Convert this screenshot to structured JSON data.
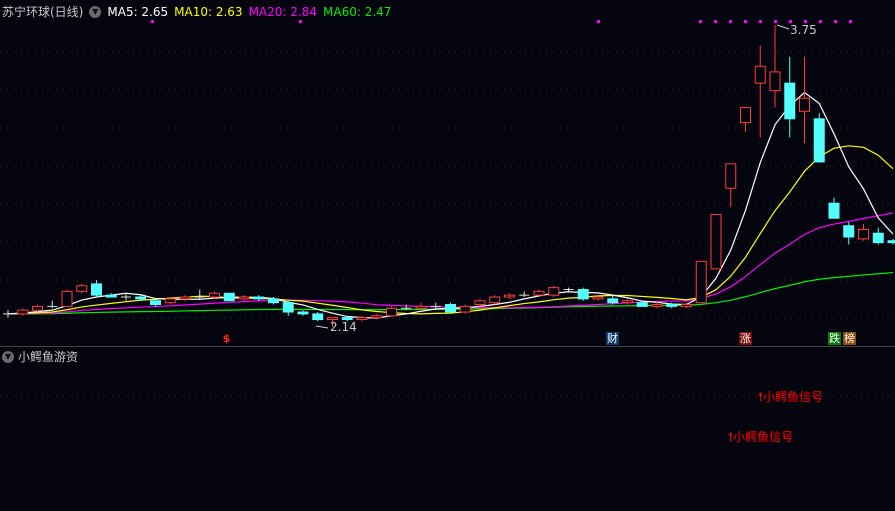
{
  "header": {
    "stock": "苏宁环球(日线)",
    "ma5": "MA5: 2.65",
    "ma10": "MA10: 2.63",
    "ma20": "MA20: 2.84",
    "ma60": "MA60: 2.47"
  },
  "colors": {
    "up": "#ff3c3c",
    "down": "#54ffff",
    "ma5": "#ffffff",
    "ma10": "#ffff00",
    "ma20": "#ff00ff",
    "ma60": "#00ee00",
    "bg": "#05050f"
  },
  "annotations": {
    "high": "3.75",
    "low": "2.14"
  },
  "markers": {
    "dollar": "$",
    "cai": "财",
    "zhang": "涨",
    "die": "跌",
    "bang": "榜"
  },
  "subpanel": {
    "title": "小鳄鱼游资",
    "signal1": "小鳄鱼信号",
    "signal2": "小鳄鱼信号"
  },
  "candles": [
    [
      2.21,
      2.23,
      2.19,
      2.21
    ],
    [
      2.21,
      2.24,
      2.2,
      2.23
    ],
    [
      2.23,
      2.26,
      2.22,
      2.25
    ],
    [
      2.25,
      2.28,
      2.24,
      2.25
    ],
    [
      2.25,
      2.34,
      2.25,
      2.33
    ],
    [
      2.33,
      2.37,
      2.32,
      2.36
    ],
    [
      2.37,
      2.39,
      2.3,
      2.31
    ],
    [
      2.31,
      2.32,
      2.3,
      2.3
    ],
    [
      2.3,
      2.32,
      2.28,
      2.3
    ],
    [
      2.3,
      2.31,
      2.28,
      2.29
    ],
    [
      2.28,
      2.29,
      2.25,
      2.26
    ],
    [
      2.27,
      2.3,
      2.26,
      2.29
    ],
    [
      2.29,
      2.31,
      2.28,
      2.3
    ],
    [
      2.3,
      2.34,
      2.29,
      2.3
    ],
    [
      2.3,
      2.33,
      2.29,
      2.32
    ],
    [
      2.32,
      2.32,
      2.28,
      2.28
    ],
    [
      2.29,
      2.31,
      2.28,
      2.3
    ],
    [
      2.3,
      2.31,
      2.28,
      2.29
    ],
    [
      2.29,
      2.3,
      2.26,
      2.27
    ],
    [
      2.27,
      2.28,
      2.2,
      2.22
    ],
    [
      2.22,
      2.23,
      2.2,
      2.21
    ],
    [
      2.21,
      2.22,
      2.17,
      2.18
    ],
    [
      2.18,
      2.19,
      2.14,
      2.19
    ],
    [
      2.19,
      2.2,
      2.17,
      2.18
    ],
    [
      2.18,
      2.2,
      2.17,
      2.19
    ],
    [
      2.19,
      2.21,
      2.18,
      2.2
    ],
    [
      2.2,
      2.25,
      2.2,
      2.24
    ],
    [
      2.24,
      2.26,
      2.23,
      2.24
    ],
    [
      2.24,
      2.27,
      2.23,
      2.25
    ],
    [
      2.25,
      2.27,
      2.24,
      2.25
    ],
    [
      2.26,
      2.27,
      2.22,
      2.22
    ],
    [
      2.22,
      2.26,
      2.21,
      2.25
    ],
    [
      2.26,
      2.29,
      2.24,
      2.28
    ],
    [
      2.27,
      2.31,
      2.26,
      2.3
    ],
    [
      2.3,
      2.32,
      2.29,
      2.31
    ],
    [
      2.31,
      2.33,
      2.3,
      2.31
    ],
    [
      2.31,
      2.34,
      2.3,
      2.33
    ],
    [
      2.31,
      2.36,
      2.3,
      2.35
    ],
    [
      2.34,
      2.35,
      2.33,
      2.34
    ],
    [
      2.34,
      2.35,
      2.28,
      2.29
    ],
    [
      2.29,
      2.31,
      2.28,
      2.3
    ],
    [
      2.29,
      2.31,
      2.26,
      2.27
    ],
    [
      2.27,
      2.29,
      2.26,
      2.28
    ],
    [
      2.27,
      2.28,
      2.25,
      2.25
    ],
    [
      2.25,
      2.28,
      2.24,
      2.26
    ],
    [
      2.26,
      2.27,
      2.24,
      2.25
    ],
    [
      2.25,
      2.27,
      2.24,
      2.26
    ],
    [
      2.27,
      2.49,
      2.27,
      2.49
    ],
    [
      2.45,
      2.74,
      2.45,
      2.74
    ],
    [
      2.88,
      3.01,
      2.78,
      3.01
    ],
    [
      3.23,
      3.31,
      3.18,
      3.31
    ],
    [
      3.44,
      3.64,
      3.15,
      3.53
    ],
    [
      3.4,
      3.75,
      3.31,
      3.5
    ],
    [
      3.44,
      3.58,
      3.15,
      3.25
    ],
    [
      3.29,
      3.58,
      3.12,
      3.36
    ],
    [
      3.25,
      3.28,
      3.02,
      3.02
    ],
    [
      2.8,
      2.83,
      2.72,
      2.72
    ],
    [
      2.68,
      2.7,
      2.58,
      2.62
    ],
    [
      2.61,
      2.69,
      2.6,
      2.66
    ],
    [
      2.64,
      2.67,
      2.58,
      2.59
    ],
    [
      2.6,
      2.61,
      2.58,
      2.59
    ]
  ]
}
